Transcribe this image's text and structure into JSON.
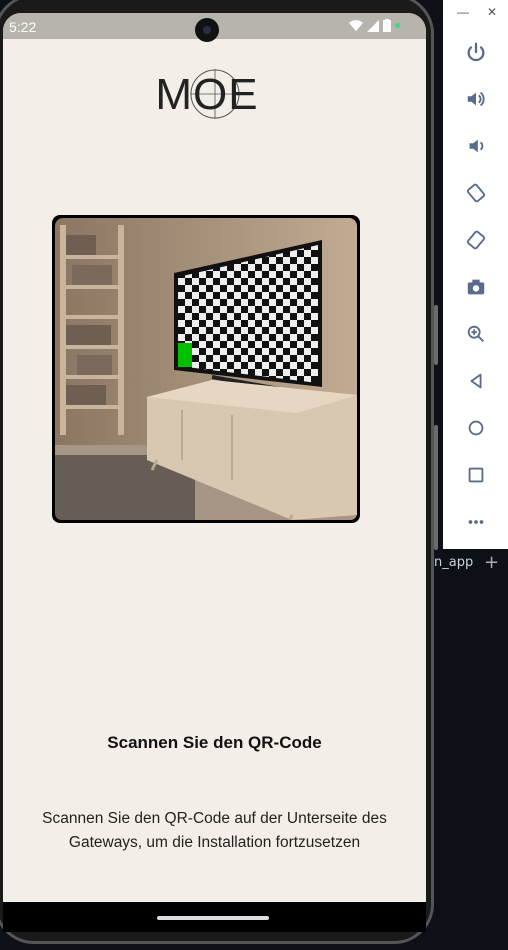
{
  "statusbar": {
    "time": "5:22"
  },
  "app": {
    "logo_text": "MOE",
    "title": "Scannen Sie den QR-Code",
    "description": "Scannen Sie den QR-Code auf der Unterseite des Gateways, um die Installation fortzusetzen"
  },
  "emulator": {
    "minimize_icon": "minimize-icon",
    "close_icon": "close-icon",
    "buttons": [
      "power-icon",
      "volume-up-icon",
      "volume-down-icon",
      "rotate-left-icon",
      "rotate-right-icon",
      "camera-icon",
      "zoom-icon",
      "back-icon",
      "home-icon",
      "overview-icon",
      "more-icon"
    ]
  },
  "terminal": {
    "tab_label": "n_app"
  },
  "colors": {
    "screen_bg": "#f3efe8",
    "status_dot": "#3ddc84",
    "tv_marker": "#00c000"
  }
}
